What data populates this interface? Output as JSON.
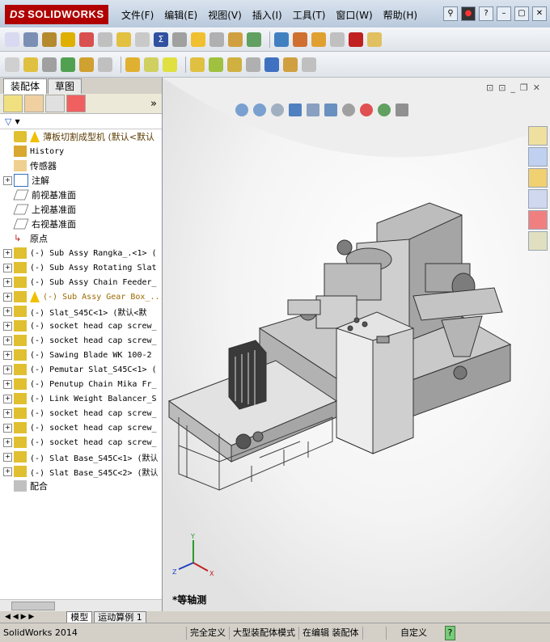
{
  "app": {
    "logo_prefix": "DS",
    "logo_text": "SOLIDWORKS"
  },
  "menu": [
    "文件(F)",
    "编辑(E)",
    "视图(V)",
    "插入(I)",
    "工具(T)",
    "窗口(W)",
    "帮助(H)"
  ],
  "window_controls": {
    "minimize": "–",
    "restore": "▢",
    "close": "✕"
  },
  "panel_tabs": [
    "装配体",
    "草图"
  ],
  "panel_expand": "»",
  "filter_label": "▼",
  "tree": {
    "root": "薄板切割成型机  (默认<默认",
    "items": [
      {
        "label": "History",
        "mono": true,
        "expand": false
      },
      {
        "label": "传感器",
        "expand": false
      },
      {
        "label": "注解",
        "expand": true
      },
      {
        "label": "前视基准面",
        "expand": false
      },
      {
        "label": "上视基准面",
        "expand": false
      },
      {
        "label": "右视基准面",
        "expand": false
      },
      {
        "label": "原点",
        "expand": false
      },
      {
        "label": "(-) Sub Assy Rangka_.<1> (",
        "mono": true,
        "expand": true
      },
      {
        "label": "(-) Sub Assy Rotating Slat",
        "mono": true,
        "expand": true
      },
      {
        "label": "(-) Sub Assy Chain Feeder_",
        "mono": true,
        "expand": true
      },
      {
        "label": "(-) Sub Assy Gear Box_...",
        "mono": true,
        "expand": true,
        "warn": true
      },
      {
        "label": "(-) Slat_S45C<1> (默认<默",
        "mono": true,
        "expand": true
      },
      {
        "label": "(-) socket head cap screw_",
        "mono": true,
        "expand": true
      },
      {
        "label": "(-) socket head cap screw_",
        "mono": true,
        "expand": true
      },
      {
        "label": "(-) Sawing Blade WK 100-2",
        "mono": true,
        "expand": true
      },
      {
        "label": "(-) Pemutar Slat_S45C<1> (",
        "mono": true,
        "expand": true
      },
      {
        "label": "(-) Penutup Chain Mika Fr_",
        "mono": true,
        "expand": true
      },
      {
        "label": "(-) Link Weight Balancer_S",
        "mono": true,
        "expand": true
      },
      {
        "label": "(-) socket head cap screw_",
        "mono": true,
        "expand": true
      },
      {
        "label": "(-) socket head cap screw_",
        "mono": true,
        "expand": true
      },
      {
        "label": "(-) socket head cap screw_",
        "mono": true,
        "expand": true
      },
      {
        "label": "(-) Slat Base_S45C<1> (默认",
        "mono": true,
        "expand": true
      },
      {
        "label": "(-) Slat Base_S45C<2> (默认",
        "mono": true,
        "expand": true
      },
      {
        "label": "配合",
        "expand": false
      }
    ]
  },
  "viewport": {
    "view_name": "*等轴测",
    "axis_labels": {
      "x": "X",
      "y": "Y",
      "z": "Z"
    }
  },
  "bottom_tabs": [
    "模型",
    "运动算例 1"
  ],
  "status": {
    "app": "SolidWorks 2014",
    "s1": "完全定义",
    "s2": "大型装配体模式",
    "s3": "在编辑 装配体",
    "s4": "自定义",
    "help": "?"
  },
  "colors": {
    "logo_red": "#b00000",
    "titlebar": "#c5d3e3",
    "panel_bg": "#ffffff",
    "warn": "#e0a000"
  }
}
